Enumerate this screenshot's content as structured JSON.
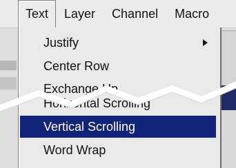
{
  "menubar": {
    "items": [
      {
        "label": "Text",
        "open": true
      },
      {
        "label": "Layer"
      },
      {
        "label": "Channel"
      },
      {
        "label": "Macro"
      }
    ]
  },
  "menu": {
    "items": [
      {
        "label": "Justify",
        "submenu": true
      },
      {
        "label": "Center Row"
      },
      {
        "label": "Exchange Up"
      },
      {
        "label": "Horizontal Scrolling"
      },
      {
        "label": "Vertical Scrolling",
        "selected": true
      },
      {
        "label": "Word Wrap"
      }
    ]
  },
  "colors": {
    "selection": "#13237a",
    "menu_bg": "#e9e9e9"
  }
}
